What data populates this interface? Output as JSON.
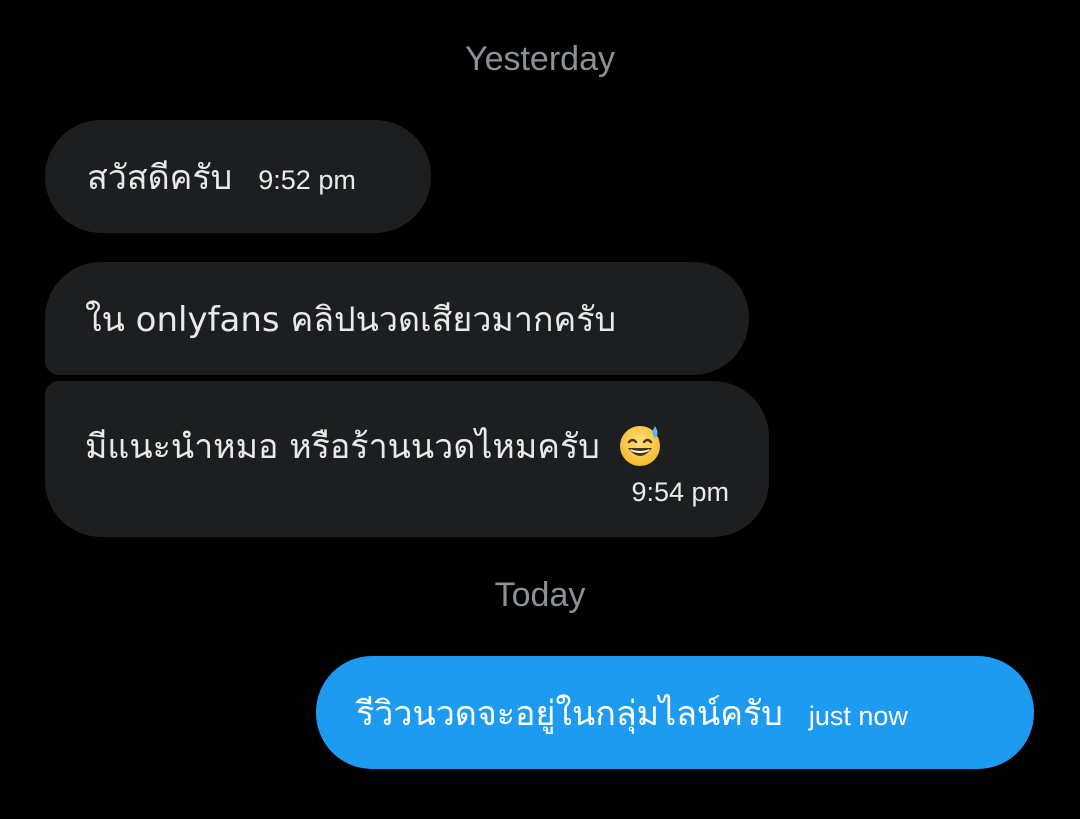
{
  "conversation": {
    "separators": {
      "yesterday": "Yesterday",
      "today": "Today"
    },
    "messages": [
      {
        "direction": "incoming",
        "text": "สวัสดีครับ",
        "time": "9:52 pm"
      },
      {
        "direction": "incoming",
        "text": "ใน onlyfans  คลิปนวดเสียวมากครับ",
        "time": ""
      },
      {
        "direction": "incoming",
        "text": "มีแนะนำหมอ หรือร้านนวดไหมครับ",
        "time": "9:54 pm",
        "emoji": "grinning-face-with-sweat-icon"
      },
      {
        "direction": "outgoing",
        "text": "รีวิวนวดจะอยู่ในกลุ่มไลน์ครับ",
        "time": "just now"
      }
    ]
  },
  "colors": {
    "background": "#000000",
    "incoming_bubble": "#1d1e20",
    "outgoing_bubble": "#1d9bf0",
    "separator_text": "#8b9197"
  }
}
